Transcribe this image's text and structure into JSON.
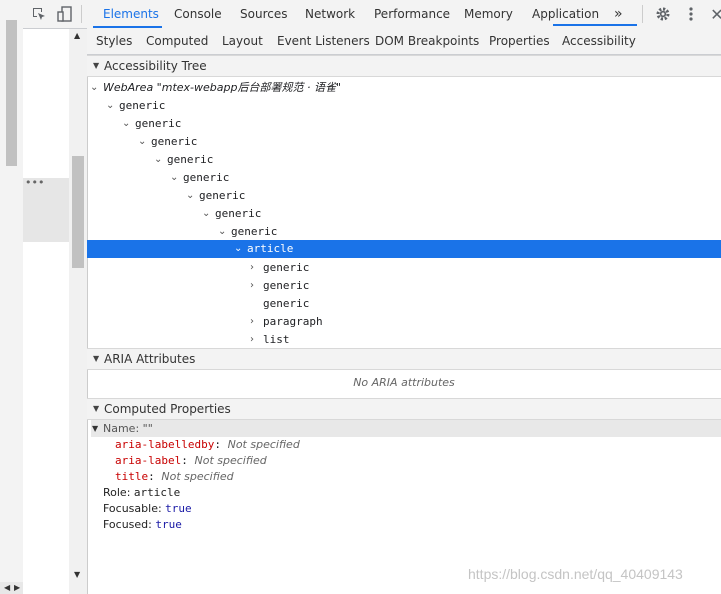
{
  "toolbar": {
    "tabs": [
      "Elements",
      "Console",
      "Sources",
      "Network",
      "Performance",
      "Memory",
      "Application"
    ],
    "active_tab": "Elements",
    "more_label": "»"
  },
  "sidebar_tabs": {
    "tabs": [
      "Styles",
      "Computed",
      "Layout",
      "Event Listeners",
      "DOM Breakpoints",
      "Properties",
      "Accessibility"
    ],
    "active_tab": "Accessibility"
  },
  "elements_panel": {
    "ellipsis": "•••"
  },
  "accessibility_tree": {
    "title": "Accessibility Tree",
    "root": "WebArea \"mtex-webapp后台部署规范 · 语雀\"",
    "nodes": [
      "generic",
      "generic",
      "generic",
      "generic",
      "generic",
      "generic",
      "generic",
      "generic",
      "article",
      "generic",
      "generic",
      "generic",
      "paragraph",
      "list"
    ]
  },
  "aria_attributes": {
    "title": "ARIA Attributes",
    "empty_text": "No ARIA attributes"
  },
  "computed_properties": {
    "title": "Computed Properties",
    "name_label": "Name: \"\"",
    "name_sources": [
      {
        "key": "aria-labelledby",
        "value": "Not specified"
      },
      {
        "key": "aria-label",
        "value": "Not specified"
      },
      {
        "key": "title",
        "value": "Not specified"
      }
    ],
    "role_label": "Role:",
    "role_value": "article",
    "focusable_label": "Focusable:",
    "focusable_value": "true",
    "focused_label": "Focused:",
    "focused_value": "true"
  },
  "watermark": "https://blog.csdn.net/qq_40409143",
  "colors": {
    "accent": "#1a73e8",
    "selected_row": "#1a73e8",
    "attr_name": "#c80000"
  }
}
